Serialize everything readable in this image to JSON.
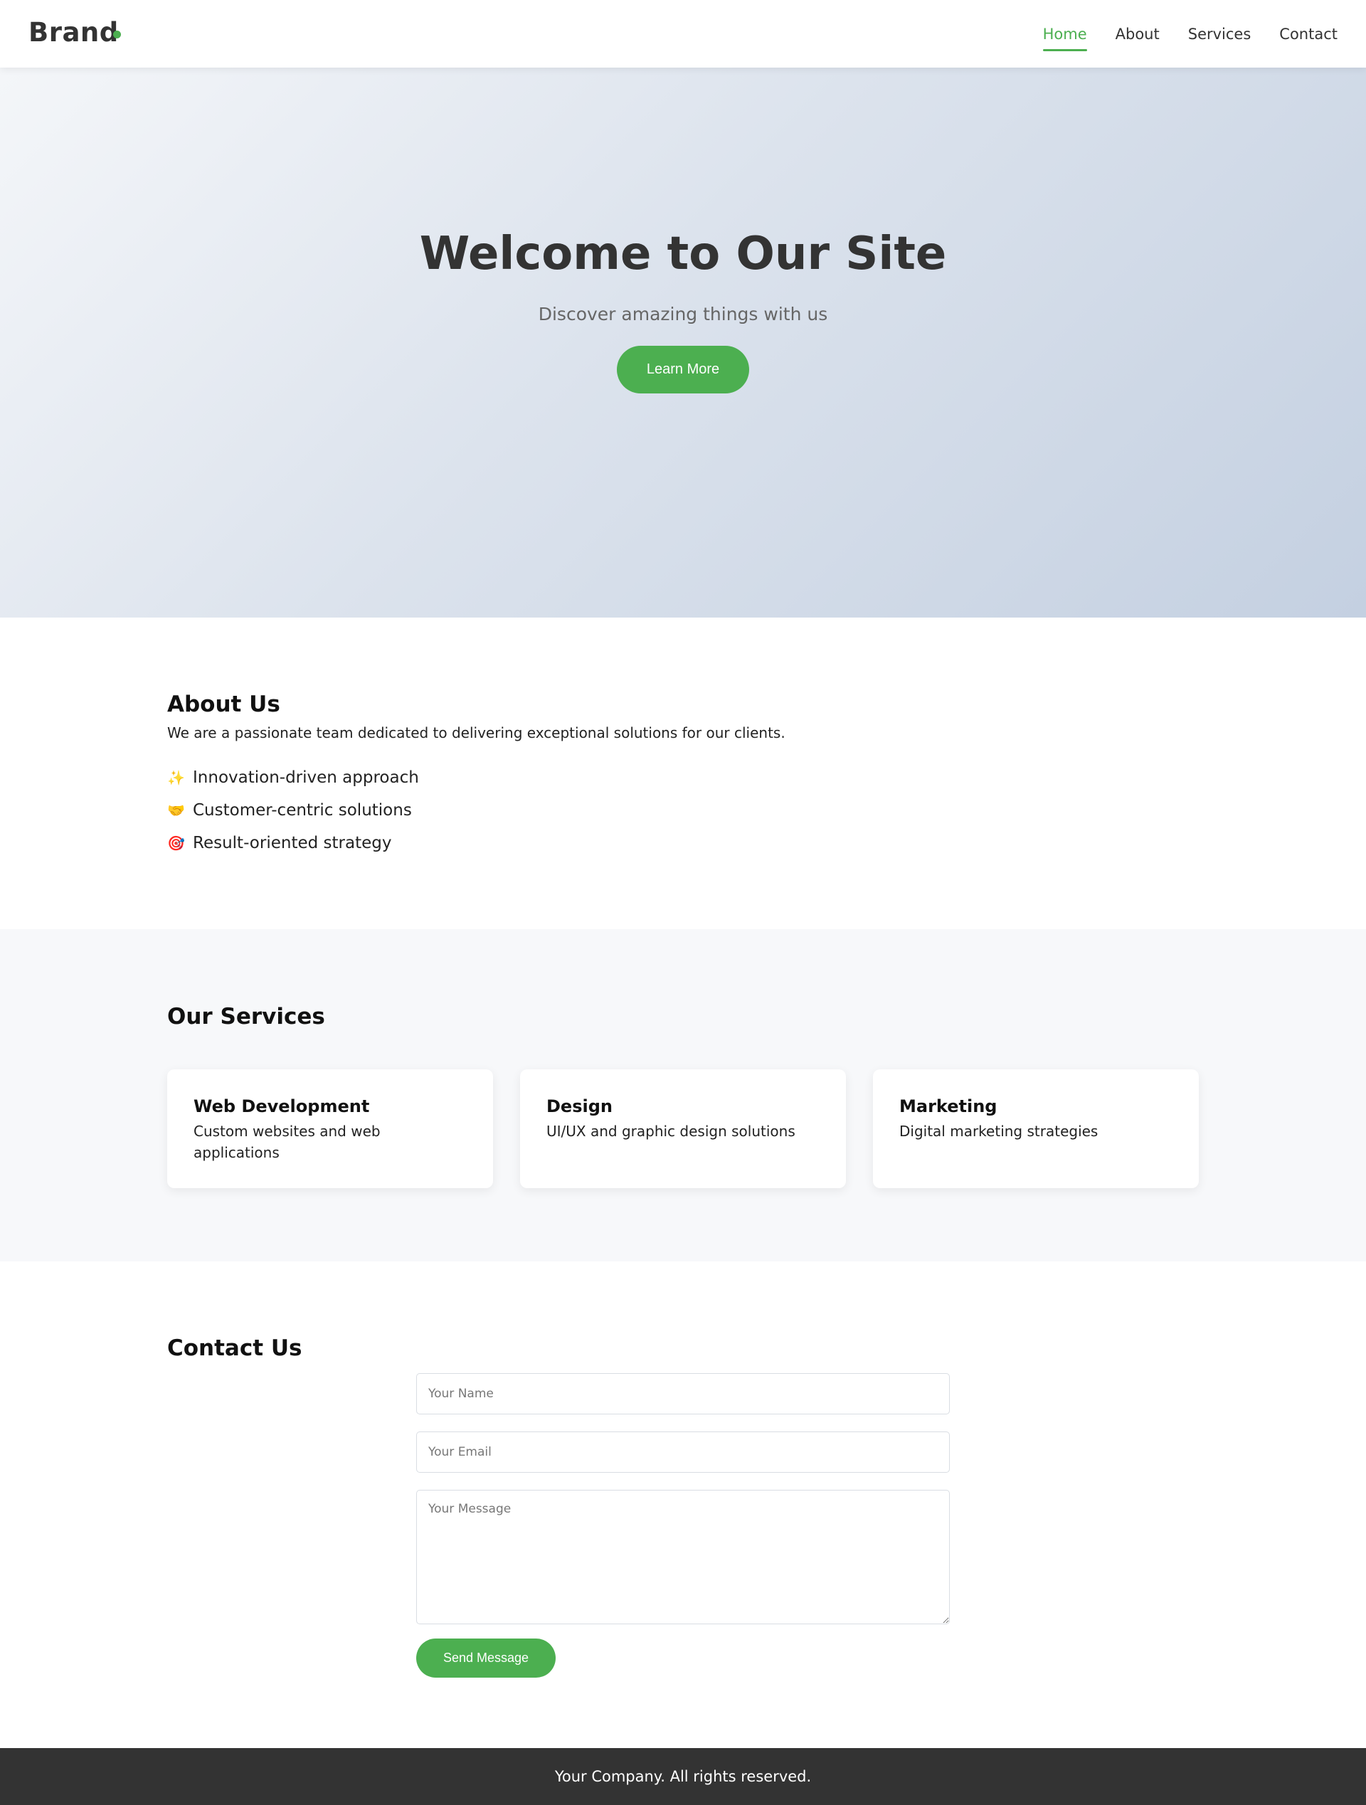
{
  "colors": {
    "accent": "#4caf50",
    "text_dark": "#333333",
    "footer_bg": "#333333",
    "services_bg": "#f7f8fa"
  },
  "header": {
    "brand": "Brand",
    "nav": [
      {
        "label": "Home",
        "active": true
      },
      {
        "label": "About",
        "active": false
      },
      {
        "label": "Services",
        "active": false
      },
      {
        "label": "Contact",
        "active": false
      }
    ]
  },
  "hero": {
    "title": "Welcome to Our Site",
    "subtitle": "Discover amazing things with us",
    "button_label": "Learn More"
  },
  "about": {
    "title": "About Us",
    "text": "We are a passionate team dedicated to delivering exceptional solutions for our clients.",
    "items": [
      {
        "icon": "sparkles-icon",
        "emoji": "✨",
        "label": "Innovation-driven approach"
      },
      {
        "icon": "handshake-icon",
        "emoji": "🤝",
        "label": "Customer-centric solutions"
      },
      {
        "icon": "target-icon",
        "emoji": "🎯",
        "label": "Result-oriented strategy"
      }
    ]
  },
  "services": {
    "title": "Our Services",
    "cards": [
      {
        "title": "Web Development",
        "description": "Custom websites and web applications"
      },
      {
        "title": "Design",
        "description": "UI/UX and graphic design solutions"
      },
      {
        "title": "Marketing",
        "description": "Digital marketing strategies"
      }
    ]
  },
  "contact": {
    "title": "Contact Us",
    "name_placeholder": "Your Name",
    "email_placeholder": "Your Email",
    "message_placeholder": "Your Message",
    "submit_label": "Send Message"
  },
  "footer": {
    "text": "Your Company. All rights reserved."
  }
}
